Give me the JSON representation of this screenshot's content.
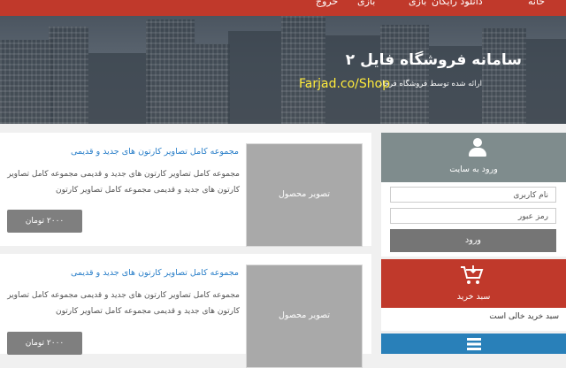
{
  "nav": {
    "items": [
      {
        "key": "home",
        "label": "خانه"
      },
      {
        "key": "download",
        "label": "دانلود رایگان"
      },
      {
        "key": "game",
        "label": "بازی"
      },
      {
        "key": "game2",
        "label": "بازی"
      },
      {
        "key": "exit",
        "label": "خروج"
      }
    ]
  },
  "header": {
    "title": "سامانه فروشگاه فایل ۲",
    "tagline": "ارائه شده توسط فروشگاه فرجاد",
    "url": "Farjad.co/Shop"
  },
  "products": [
    {
      "title": "مجموعه کامل تصاویر کارتون های جدید و قدیمی",
      "description": "مجموعه کامل تصاویر کارتون های جدید و قدیمی مجموعه کامل تصاویر کارتون های جدید و قدیمی مجموعه کامل تصاویر کارتون",
      "image_label": "تصویر محصول",
      "price": "۲۰۰۰ تومان"
    },
    {
      "title": "مجموعه کامل تصاویر کارتون های جدید و قدیمی",
      "description": "مجموعه کامل تصاویر کارتون های جدید و قدیمی مجموعه کامل تصاویر کارتون های جدید و قدیمی مجموعه کامل تصاویر کارتون",
      "image_label": "تصویر محصول",
      "price": "۲۰۰۰ تومان"
    }
  ],
  "sidebar": {
    "login": {
      "title": "ورود به سایت",
      "username_placeholder": "نام کاربری",
      "password_placeholder": "رمز عبور",
      "button": "ورود"
    },
    "cart": {
      "title": "سبد خرید",
      "empty_message": "سبد خرید خالی است"
    }
  },
  "colors": {
    "nav": "#c0392b",
    "login_header": "#7f8c8d",
    "cart_header": "#c0392b",
    "blue_header": "#2980b9",
    "link": "#2a7fc9",
    "url": "#ffeb3b"
  },
  "icons": {
    "login": "user-icon",
    "cart": "cart-icon",
    "blue_box": "list-icon"
  }
}
